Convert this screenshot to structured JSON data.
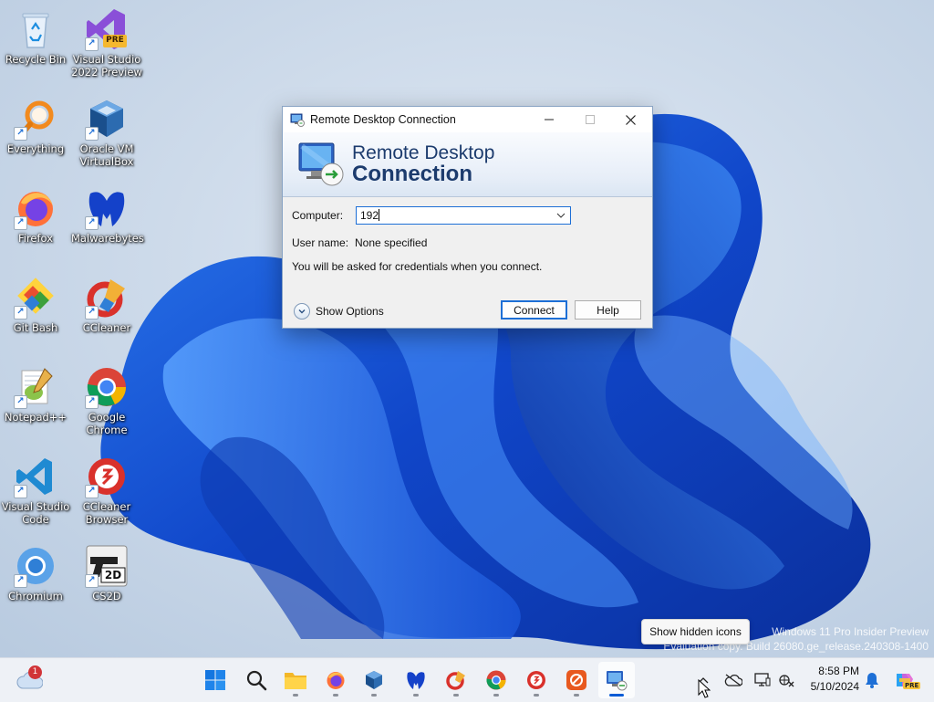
{
  "desktop": {
    "icons": [
      {
        "label": "Recycle Bin",
        "icon": "recycle-bin-icon"
      },
      {
        "label": "Visual Studio 2022 Preview",
        "icon": "visual-studio-preview-icon",
        "badge": "PRE"
      },
      {
        "label": "Everything",
        "icon": "everything-search-icon"
      },
      {
        "label": "Oracle VM VirtualBox",
        "icon": "virtualbox-icon"
      },
      {
        "label": "Firefox",
        "icon": "firefox-icon"
      },
      {
        "label": "Malwarebytes",
        "icon": "malwarebytes-icon"
      },
      {
        "label": "Git Bash",
        "icon": "git-bash-icon"
      },
      {
        "label": "CCleaner",
        "icon": "ccleaner-icon"
      },
      {
        "label": "Notepad++",
        "icon": "notepad-plus-plus-icon"
      },
      {
        "label": "Google Chrome",
        "icon": "google-chrome-icon"
      },
      {
        "label": "Visual Studio Code",
        "icon": "vscode-icon"
      },
      {
        "label": "CCleaner Browser",
        "icon": "ccleaner-browser-icon"
      },
      {
        "label": "Chromium",
        "icon": "chromium-icon"
      },
      {
        "label": "CS2D",
        "icon": "cs2d-icon",
        "badge": "2D"
      }
    ]
  },
  "dialog": {
    "title": "Remote Desktop Connection",
    "banner_line1": "Remote Desktop",
    "banner_line2": "Connection",
    "computer_label": "Computer:",
    "computer_value": "192",
    "username_label": "User name:",
    "username_value": "None specified",
    "credentials_note": "You will be asked for credentials when you connect.",
    "show_options": "Show Options",
    "connect": "Connect",
    "help": "Help"
  },
  "tooltip": "Show hidden icons",
  "watermark": {
    "line1": "Windows 11 Pro Insider Preview",
    "line2": "Evaluation copy. Build 26080.ge_release.240308-1400"
  },
  "taskbar": {
    "weather_badge": "1",
    "apps": [
      {
        "name": "start-button",
        "icon": "windows-logo-icon"
      },
      {
        "name": "search",
        "icon": "search-icon"
      },
      {
        "name": "file-explorer",
        "icon": "folder-icon"
      },
      {
        "name": "firefox",
        "icon": "firefox-icon"
      },
      {
        "name": "virtualbox",
        "icon": "virtualbox-icon"
      },
      {
        "name": "malwarebytes",
        "icon": "malwarebytes-icon"
      },
      {
        "name": "ccleaner",
        "icon": "ccleaner-icon"
      },
      {
        "name": "chrome",
        "icon": "google-chrome-icon"
      },
      {
        "name": "ccleaner-browser",
        "icon": "ccleaner-browser-icon"
      },
      {
        "name": "app-orange",
        "icon": "orange-app-icon"
      },
      {
        "name": "remote-desktop",
        "icon": "remote-desktop-icon"
      }
    ],
    "time": "8:58 PM",
    "date": "5/10/2024",
    "copilot_badge": "PRE"
  },
  "colors": {
    "accent": "#1d6fd6",
    "banner_text": "#1c3b6d",
    "wallpaper_bg": "#c9d7e8",
    "bloom": "#1a55d8"
  }
}
